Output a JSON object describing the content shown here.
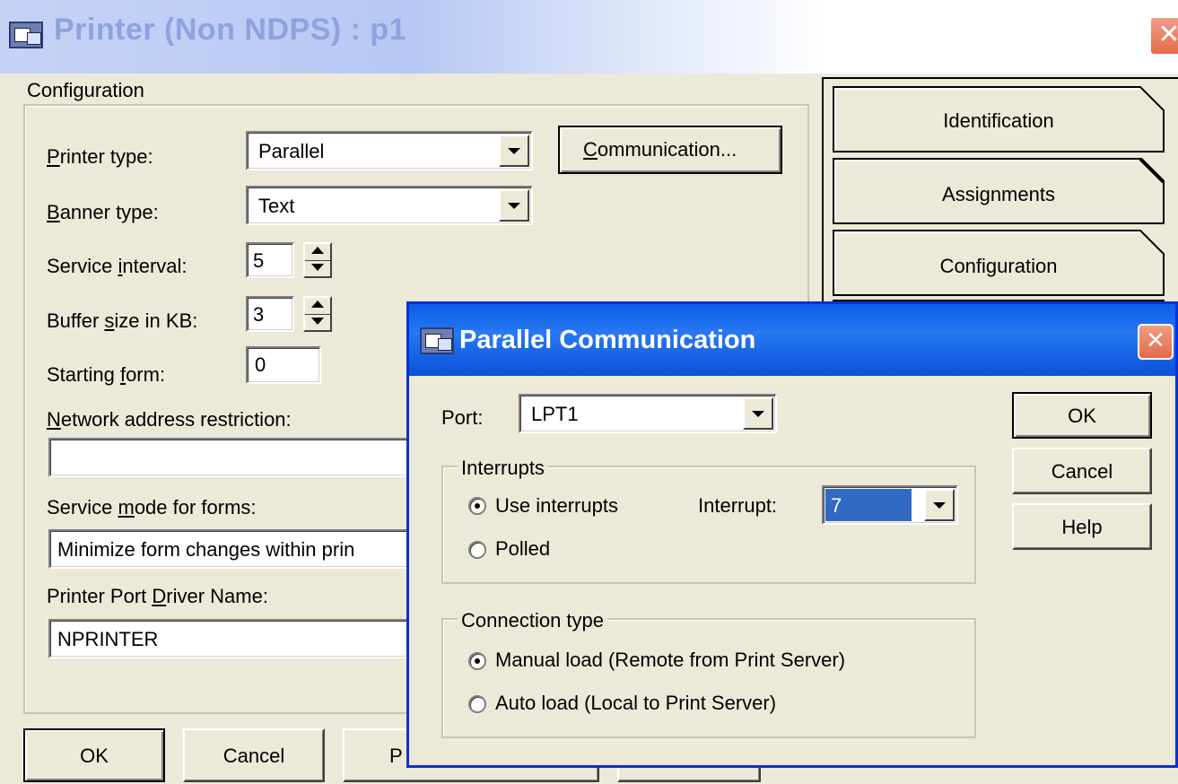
{
  "main_window": {
    "title": "Printer (Non NDPS) : p1",
    "section_title": "Configuration",
    "printer_type": {
      "label_key": "P",
      "label_rest": "rinter type:",
      "value": "Parallel"
    },
    "communication_button": {
      "key": "C",
      "rest": "ommunication..."
    },
    "banner_type": {
      "label_key": "B",
      "label_rest": "anner type:",
      "value": "Text"
    },
    "service_interval": {
      "label_pre": "Service ",
      "label_key": "i",
      "label_rest": "nterval:",
      "value": "5"
    },
    "buffer_size": {
      "label_pre": "Buffer ",
      "label_key": "s",
      "label_rest": "ize in KB:",
      "value": "3"
    },
    "starting_form": {
      "label_pre": "Starting ",
      "label_key": "f",
      "label_rest": "orm:",
      "value": "0"
    },
    "network_restriction": {
      "label_key": "N",
      "label_rest": "etwork address restriction:",
      "value": ""
    },
    "service_mode": {
      "label_pre": "Service ",
      "label_key": "m",
      "label_rest": "ode for forms:",
      "value": "Minimize form changes within prin"
    },
    "port_driver": {
      "label_pre": "Printer Port ",
      "label_key": "D",
      "label_rest": "river Name:",
      "value": "NPRINTER"
    },
    "tabs": [
      "Identification",
      "Assignments",
      "Configuration"
    ],
    "bottom_buttons": {
      "ok": "OK",
      "cancel": "Cancel",
      "third_partial": "P"
    }
  },
  "dialog": {
    "title": "Parallel Communication",
    "port_label": "Port:",
    "port_value": "LPT1",
    "interrupts_group": "Interrupts",
    "use_interrupts": "Use interrupts",
    "polled": "Polled",
    "interrupt_label": "Interrupt:",
    "interrupt_value": "7",
    "connection_group": "Connection type",
    "manual_load": "Manual load (Remote from Print Server)",
    "auto_load": "Auto load (Local to Print Server)",
    "ok": "OK",
    "cancel": "Cancel",
    "help": "Help"
  },
  "colors": {
    "title_active": "#0a5ce6",
    "title_inactive": "#b6c8f3",
    "selection": "#316ac5"
  }
}
